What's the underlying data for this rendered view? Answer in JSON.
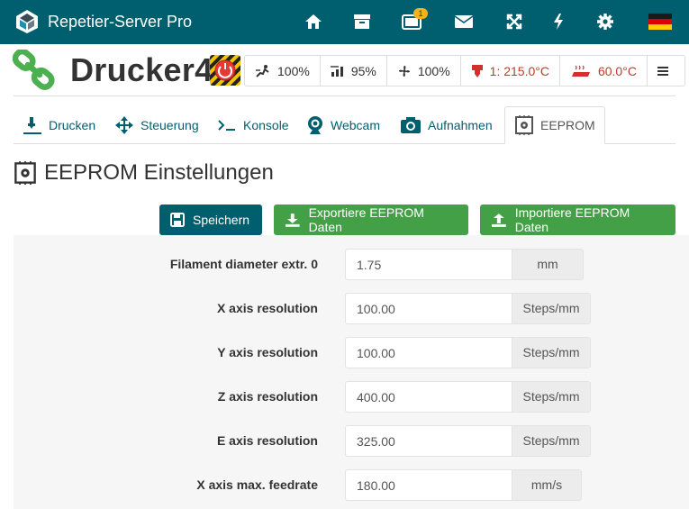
{
  "navbar": {
    "title": "Repetier-Server Pro",
    "badge_count": "1",
    "icons": [
      "home-icon",
      "archive-icon",
      "tablet-icon",
      "mail-icon",
      "fullscreen-icon",
      "bolt-icon",
      "gear-icon",
      "flag-de-icon"
    ],
    "colors": {
      "background": "#005f6e",
      "badge": "#f5b21c"
    }
  },
  "printer": {
    "name": "Drucker4",
    "status": {
      "speed": "100%",
      "flow": "95%",
      "fan": "100%",
      "extruder_temp": "1: 215.0°C",
      "bed_temp": "60.0°C"
    }
  },
  "tabs": [
    {
      "label": "Drucken",
      "icon": "print-nozzle-icon"
    },
    {
      "label": "Steuerung",
      "icon": "move-arrows-icon"
    },
    {
      "label": "Konsole",
      "icon": "terminal-icon"
    },
    {
      "label": "Webcam",
      "icon": "webcam-icon"
    },
    {
      "label": "Aufnahmen",
      "icon": "camera-icon"
    },
    {
      "label": "EEPROM",
      "icon": "chip-icon",
      "active": true
    }
  ],
  "page": {
    "title": "EEPROM Einstellungen"
  },
  "buttons": {
    "save": "Speichern",
    "export": "Exportiere EEPROM Daten",
    "import": "Importiere EEPROM Daten"
  },
  "settings": [
    {
      "label": "Filament diameter extr. 0",
      "value": "1.75",
      "unit": "mm"
    },
    {
      "label": "X axis resolution",
      "value": "100.00",
      "unit": "Steps/mm"
    },
    {
      "label": "Y axis resolution",
      "value": "100.00",
      "unit": "Steps/mm"
    },
    {
      "label": "Z axis resolution",
      "value": "400.00",
      "unit": "Steps/mm"
    },
    {
      "label": "E axis resolution",
      "value": "325.00",
      "unit": "Steps/mm"
    },
    {
      "label": "X axis max. feedrate",
      "value": "180.00",
      "unit": "mm/s"
    }
  ],
  "colors": {
    "primary": "#005f6e",
    "success": "#43a047",
    "link_green": "#4caf50",
    "temp_red": "#c0392b"
  }
}
